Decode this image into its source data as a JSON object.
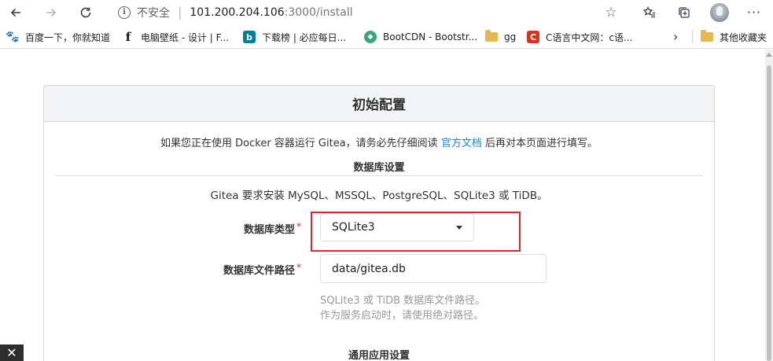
{
  "browser": {
    "security_label": "不安全",
    "url_host": "101.200.204.106",
    "url_rest": ":3000/install"
  },
  "bookmarks": [
    {
      "label": "百度一下，你就知道",
      "icon": "paw-icon",
      "color": "#2932e1"
    },
    {
      "label": "电脑壁纸 - 设计 | F...",
      "icon": "f-logo-icon",
      "color": "#111111"
    },
    {
      "label": "下载榜 | 必应每日...",
      "icon": "bing-icon",
      "color": "#00809d"
    },
    {
      "label": "BootCDN - Bootstr...",
      "icon": "bootcdn-icon",
      "color": "#3aa876"
    },
    {
      "label": "gg",
      "icon": "folder-icon",
      "color": "#e7b94c"
    },
    {
      "label": "C语言中文网：c语...",
      "icon": "c-logo-icon",
      "color": "#d9321f"
    }
  ],
  "other_bookmarks_label": "其他收藏夹",
  "page": {
    "title": "初始配置",
    "notice_before": "如果您正在使用 Docker 容器运行 Gitea，请务必先仔细阅读 ",
    "notice_link": "官方文档",
    "notice_after": " 后再对本页面进行填写。",
    "db_section_title": "数据库设置",
    "db_requires": "Gitea 要求安装 MySQL、MSSQL、PostgreSQL、SQLite3 或 TiDB。",
    "db_type_label": "数据库类型",
    "db_type_value": "SQLite3",
    "db_path_label": "数据库文件路径",
    "db_path_value": "data/gitea.db",
    "db_path_help_1": "SQLite3 或 TiDB 数据库文件路径。",
    "db_path_help_2": "作为服务启动时，请使用绝对路径。",
    "general_section_title": "通用应用设置",
    "required_mark": "*"
  },
  "toast_icon": "✕"
}
